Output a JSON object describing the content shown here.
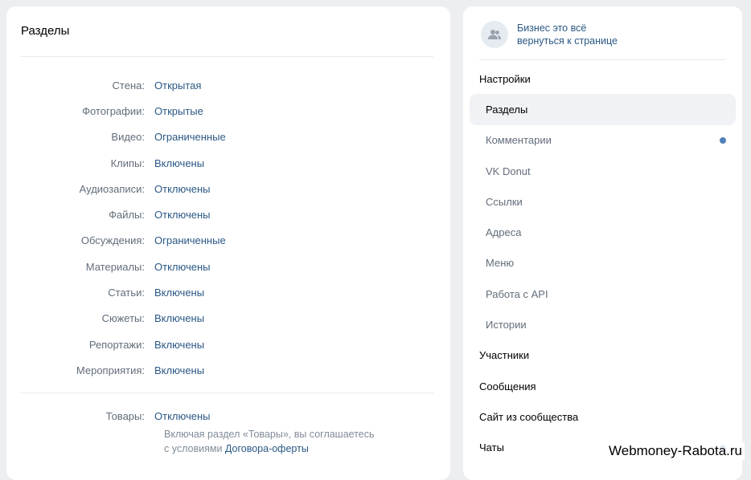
{
  "main": {
    "title": "Разделы",
    "sections": [
      {
        "label": "Стена:",
        "value": "Открытая"
      },
      {
        "label": "Фотографии:",
        "value": "Открытые"
      },
      {
        "label": "Видео:",
        "value": "Ограниченные"
      },
      {
        "label": "Клипы:",
        "value": "Включены"
      },
      {
        "label": "Аудиозаписи:",
        "value": "Отключены"
      },
      {
        "label": "Файлы:",
        "value": "Отключены"
      },
      {
        "label": "Обсуждения:",
        "value": "Ограниченные"
      },
      {
        "label": "Материалы:",
        "value": "Отключены"
      },
      {
        "label": "Статьи:",
        "value": "Включены"
      },
      {
        "label": "Сюжеты:",
        "value": "Включены"
      },
      {
        "label": "Репортажи:",
        "value": "Включены"
      },
      {
        "label": "Мероприятия:",
        "value": "Включены"
      }
    ],
    "goods": {
      "label": "Товары:",
      "value": "Отключены",
      "note_line1": "Включая раздел «Товары», вы соглашаетесь",
      "note_prefix": "с условиями ",
      "note_link": "Договора-оферты"
    }
  },
  "sidebar": {
    "group_name": "Бизнес это всё",
    "back_link": "вернуться к странице",
    "avatar_icon": "group-people-icon",
    "menu": [
      {
        "label": "Настройки",
        "level": 0
      },
      {
        "label": "Разделы",
        "level": 1,
        "active": true
      },
      {
        "label": "Комментарии",
        "level": 1,
        "dot": true
      },
      {
        "label": "VK Donut",
        "level": 1
      },
      {
        "label": "Ссылки",
        "level": 1
      },
      {
        "label": "Адреса",
        "level": 1
      },
      {
        "label": "Меню",
        "level": 1
      },
      {
        "label": "Работа с API",
        "level": 1
      },
      {
        "label": "Истории",
        "level": 1
      },
      {
        "label": "Участники",
        "level": 0
      },
      {
        "label": "Сообщения",
        "level": 0
      },
      {
        "label": "Сайт из сообщества",
        "level": 0
      },
      {
        "label": "Чаты",
        "level": 0,
        "dot": true
      }
    ]
  },
  "watermark": "Webmoney-Rabota.ru",
  "colors": {
    "background": "#edeef0",
    "link": "#2a5885",
    "label": "#626d7a",
    "dot": "#5181b8",
    "active_bg": "#f0f2f5"
  }
}
